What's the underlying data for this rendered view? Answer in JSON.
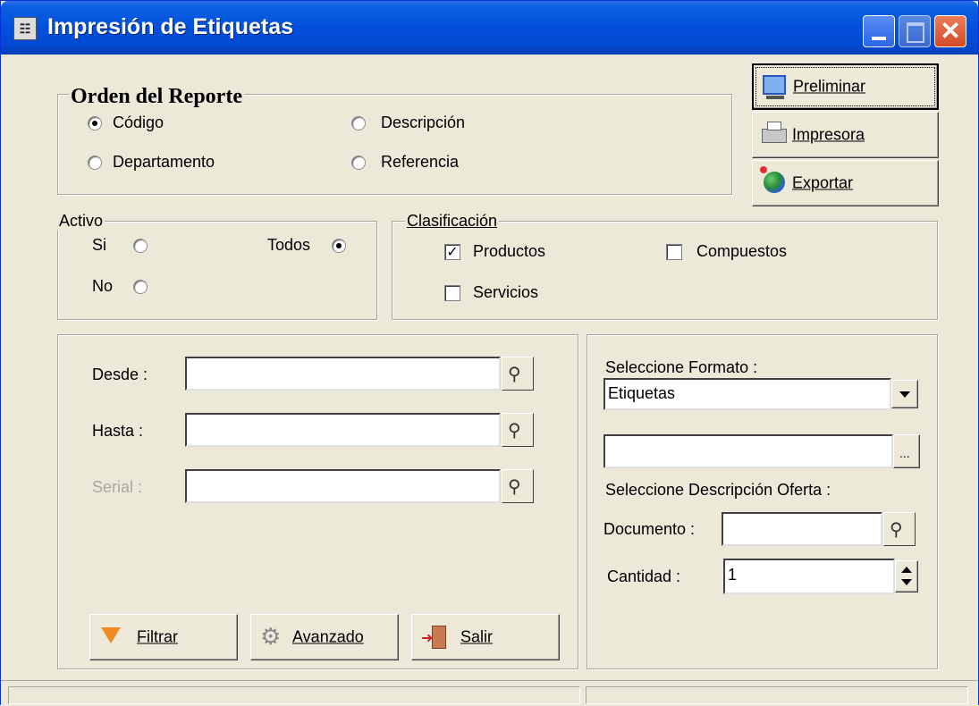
{
  "window": {
    "title": "Impresión de Etiquetas"
  },
  "orden": {
    "legend": "Orden del Reporte",
    "options": [
      {
        "label": "Código",
        "selected": true
      },
      {
        "label": "Descripción",
        "selected": false
      },
      {
        "label": "Departamento",
        "selected": false
      },
      {
        "label": "Referencia",
        "selected": false
      }
    ]
  },
  "actions": {
    "preliminar": "Preliminar",
    "impresora": "Impresora",
    "exportar": "Exportar"
  },
  "activo": {
    "legend": "Activo",
    "si": "Si",
    "no": "No",
    "todos": "Todos",
    "selected": "Todos"
  },
  "clasificacion": {
    "legend": "Clasificación",
    "productos": {
      "label": "Productos",
      "checked": true
    },
    "compuestos": {
      "label": "Compuestos",
      "checked": false
    },
    "servicios": {
      "label": "Servicios",
      "checked": false
    }
  },
  "range": {
    "desde_label": "Desde  :",
    "desde_value": "",
    "hasta_label": "Hasta  :",
    "hasta_value": "",
    "serial_label": "Serial :",
    "serial_value": ""
  },
  "formato": {
    "label": "Seleccione Formato :",
    "selected": "Etiquetas",
    "path_value": "",
    "browse": "...",
    "oferta_label": "Seleccione Descripción Oferta :",
    "documento_label": "Documento :",
    "documento_value": "",
    "cantidad_label": "Cantidad :",
    "cantidad_value": "1"
  },
  "bottom_buttons": {
    "filtrar": "Filtrar",
    "avanzado": "Avanzado",
    "salir": "Salir"
  },
  "colors": {
    "titlebar": "#0350dc",
    "face": "#ece9d8",
    "close": "#d24b28"
  }
}
